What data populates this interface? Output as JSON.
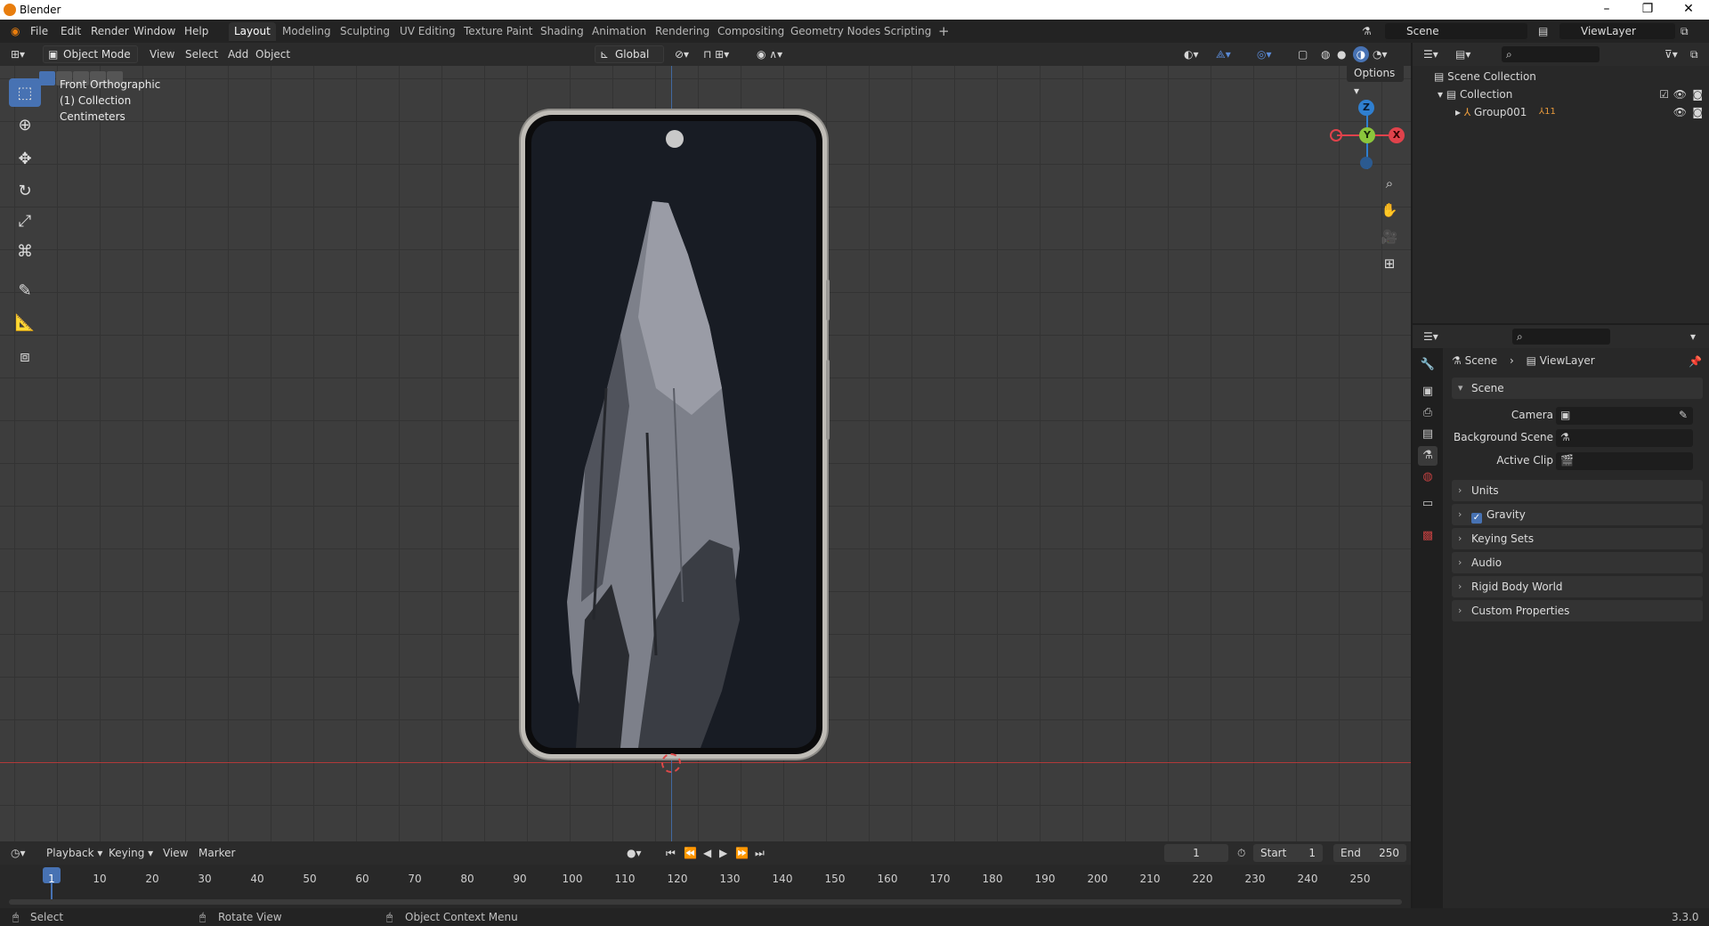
{
  "window": {
    "title": "Blender",
    "minimize": "–",
    "maximize": "❐",
    "close": "✕"
  },
  "menu": [
    "File",
    "Edit",
    "Render",
    "Window",
    "Help"
  ],
  "workspaces": [
    "Layout",
    "Modeling",
    "Sculpting",
    "UV Editing",
    "Texture Paint",
    "Shading",
    "Animation",
    "Rendering",
    "Compositing",
    "Geometry Nodes",
    "Scripting",
    "+"
  ],
  "scene_field": "Scene",
  "viewlayer_field": "ViewLayer",
  "viewport_header": {
    "mode": "Object Mode",
    "menus": [
      "View",
      "Select",
      "Add",
      "Object"
    ],
    "orientation": "Global",
    "options": "Options"
  },
  "overlay": {
    "view_name": "Front Orthographic",
    "collection": "(1) Collection",
    "units": "Centimeters"
  },
  "gizmo": {
    "z": "Z",
    "y": "Y",
    "x": "X"
  },
  "outliner": {
    "scene_collection": "Scene Collection",
    "collection": "Collection",
    "group": "Group001",
    "group_badge": "11"
  },
  "properties": {
    "breadcrumb_scene": "Scene",
    "breadcrumb_layer": "ViewLayer",
    "scene_section": "Scene",
    "camera_label": "Camera",
    "background_scene_label": "Background Scene",
    "active_clip_label": "Active Clip",
    "sections": [
      "Units",
      "Gravity",
      "Keying Sets",
      "Audio",
      "Rigid Body World",
      "Custom Properties"
    ]
  },
  "timeline": {
    "menus": [
      "Playback",
      "Keying",
      "View",
      "Marker"
    ],
    "current_frame": "1",
    "start_label": "Start",
    "start": "1",
    "end_label": "End",
    "end": "250",
    "ticks": [
      "1",
      "10",
      "20",
      "30",
      "40",
      "50",
      "60",
      "70",
      "80",
      "90",
      "100",
      "110",
      "120",
      "130",
      "140",
      "150",
      "160",
      "170",
      "180",
      "190",
      "200",
      "210",
      "220",
      "230",
      "240",
      "250"
    ]
  },
  "statusbar": {
    "select": "Select",
    "rotate": "Rotate View",
    "context": "Object Context Menu",
    "version": "3.3.0"
  },
  "colors": {
    "accent": "#4772b3",
    "x_axis": "#e0424b",
    "y_axis": "#8bc63c",
    "z_axis": "#2f7fd0"
  }
}
